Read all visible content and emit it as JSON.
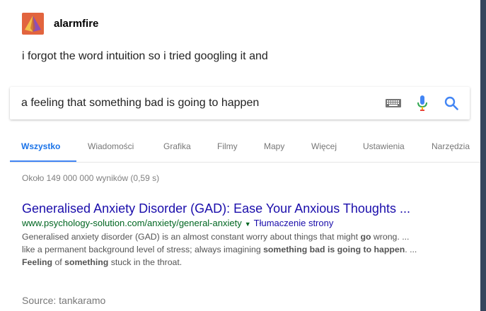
{
  "post": {
    "username": "alarmfire",
    "caption": "i forgot the word intuition so i tried googling it and",
    "source": "Source: tankaramo"
  },
  "search": {
    "query": "a feeling that something bad is going to happen",
    "icons": [
      "keyboard-icon",
      "microphone-icon",
      "search-icon"
    ]
  },
  "tabs": [
    {
      "label": "Wszystko",
      "active": true
    },
    {
      "label": "Wiadomości",
      "active": false
    },
    {
      "label": "Grafika",
      "active": false
    },
    {
      "label": "Filmy",
      "active": false
    },
    {
      "label": "Mapy",
      "active": false
    },
    {
      "label": "Więcej",
      "active": false
    },
    {
      "label": "Ustawienia",
      "active": false
    },
    {
      "label": "Narzędzia",
      "active": false
    }
  ],
  "results_stats": "Około 149 000 000 wyników (0,59 s)",
  "result": {
    "title": "Generalised Anxiety Disorder (GAD): Ease Your Anxious Thoughts ...",
    "url": "www.psychology-solution.com/anxiety/general-anxiety",
    "arrow": "▼",
    "translate": "Tłumaczenie strony",
    "snippet_line1_a": "Generalised anxiety disorder (GAD) is an almost constant worry about things that might ",
    "snippet_line1_b": "go",
    "snippet_line1_c": " wrong. ...",
    "snippet_line2_a": "like a permanent background level of stress; always imagining ",
    "snippet_line2_b": "something bad is going to happen",
    "snippet_line2_c": ". ...",
    "snippet_line3_a": "Feeling",
    "snippet_line3_b": " of ",
    "snippet_line3_c": "something",
    "snippet_line3_d": " stuck in the throat."
  },
  "colors": {
    "link": "#1a0dab",
    "url": "#006621",
    "active_tab": "#1a73e8",
    "avatar": "#e2643e",
    "page_bg": "#36465d"
  }
}
